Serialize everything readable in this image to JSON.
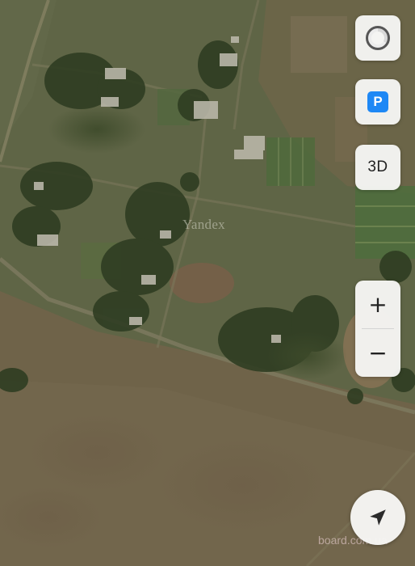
{
  "map": {
    "type": "satellite",
    "provider_watermark": "Yandex",
    "site_watermark": "board.com.ua"
  },
  "controls": {
    "traffic": {
      "icon": "traffic-ring-icon"
    },
    "parking": {
      "label": "P",
      "color": "#1e88f5"
    },
    "mode3d": {
      "label": "3D"
    },
    "zoom_in": {
      "label": "+"
    },
    "zoom_out": {
      "label": "−"
    },
    "locate": {
      "icon": "navigation-arrow-icon"
    }
  }
}
